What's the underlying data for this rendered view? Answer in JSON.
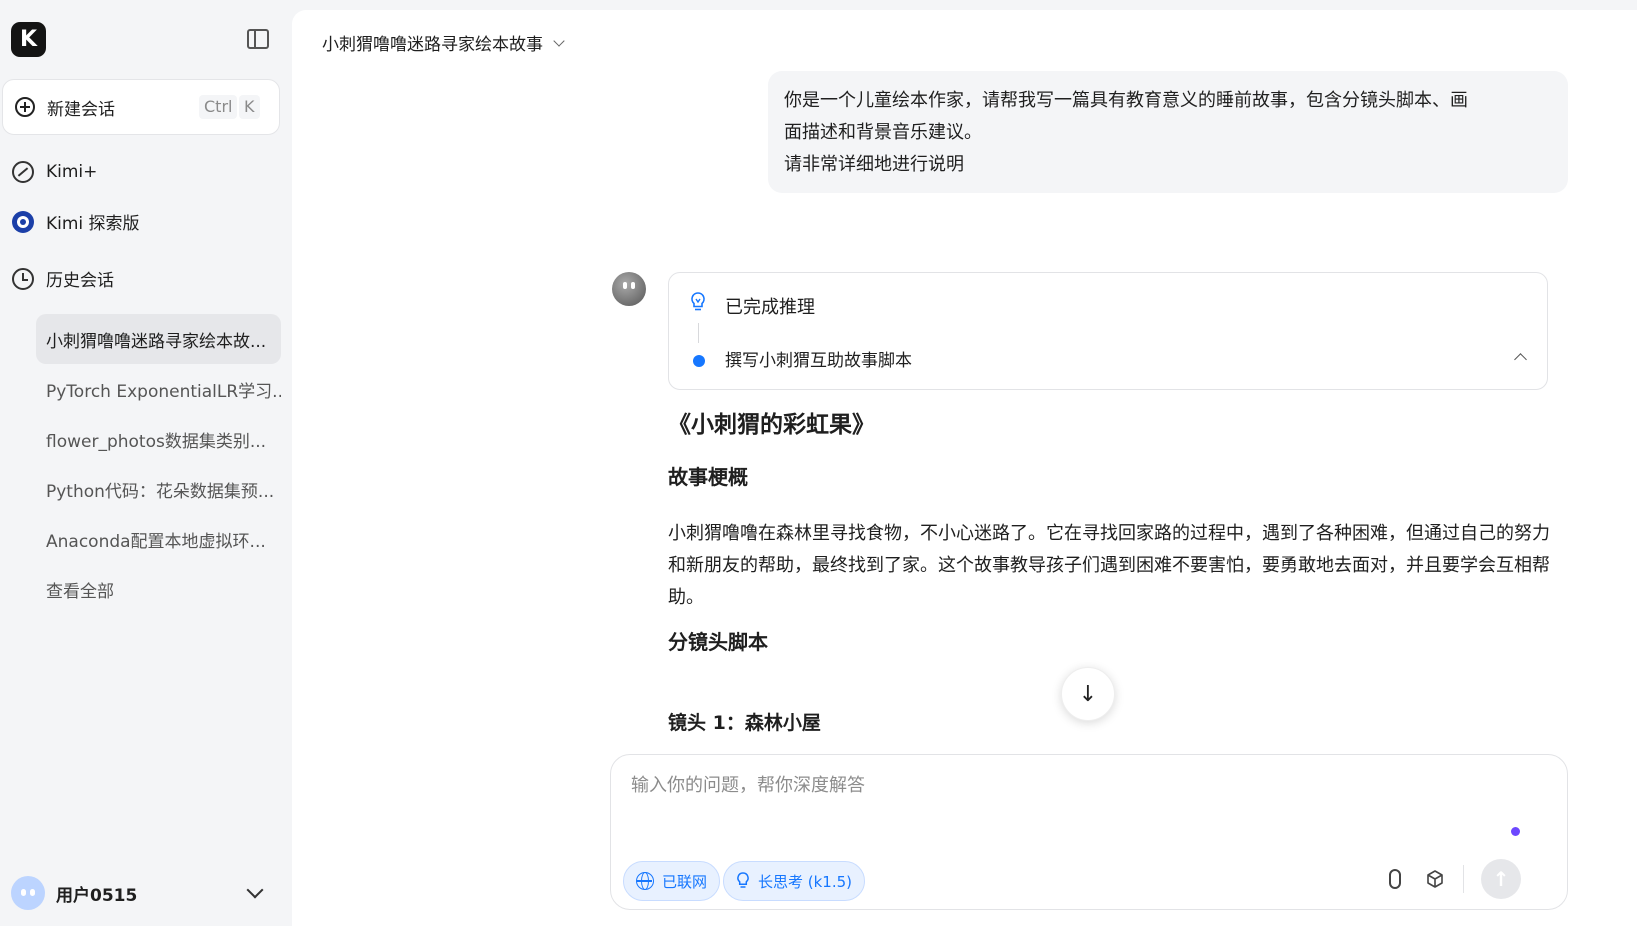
{
  "sidebar": {
    "logo": "K",
    "new_chat": {
      "label": "新建会话",
      "shortcut_ctrl": "Ctrl",
      "shortcut_key": "K"
    },
    "nav": [
      {
        "label": "Kimi+",
        "icon": "kimi-plus-icon"
      },
      {
        "label": "Kimi 探索版",
        "icon": "explore-icon"
      },
      {
        "label": "历史会话",
        "icon": "clock-icon"
      }
    ],
    "history": [
      "小刺猬噜噜迷路寻家绘本故...",
      "PyTorch ExponentialLR学习...",
      "flower_photos数据集类别...",
      "Python代码：花朵数据集预...",
      "Anaconda配置本地虚拟环...",
      "查看全部"
    ],
    "user": {
      "name": "用户0515"
    }
  },
  "main": {
    "conversation_title": "小刺猬噜噜迷路寻家绘本故事",
    "user_message": {
      "line1": "你是一个儿童绘本作家，请帮我写一篇具有教育意义的睡前故事，包含分镜头脚本、画",
      "line2": "面描述和背景音乐建议。",
      "line3": "请非常详细地进行说明"
    },
    "reasoning": {
      "title": "已完成推理",
      "step": "撰写小刺猬互助故事脚本"
    },
    "answer": {
      "title": "《小刺猬的彩虹果》",
      "summary_heading": "故事梗概",
      "summary_text": "小刺猬噜噜在森林里寻找食物，不小心迷路了。它在寻找回家路的过程中，遇到了各种困难，但通过自己的努力和新朋友的帮助，最终找到了家。这个故事教导孩子们遇到困难不要害怕，要勇敢地去面对，并且要学会互相帮助。",
      "script_heading": "分镜头脚本",
      "shot1_heading": "镜头 1：森林小屋"
    },
    "scroll_down_icon": "↓",
    "input": {
      "placeholder": "输入你的问题，帮你深度解答",
      "web_pill": "已联网",
      "think_pill": "长思考 (k1.5)",
      "send_icon": "↑"
    }
  },
  "colors": {
    "accent": "#1677ff",
    "purple_dot": "#6c47ff"
  }
}
